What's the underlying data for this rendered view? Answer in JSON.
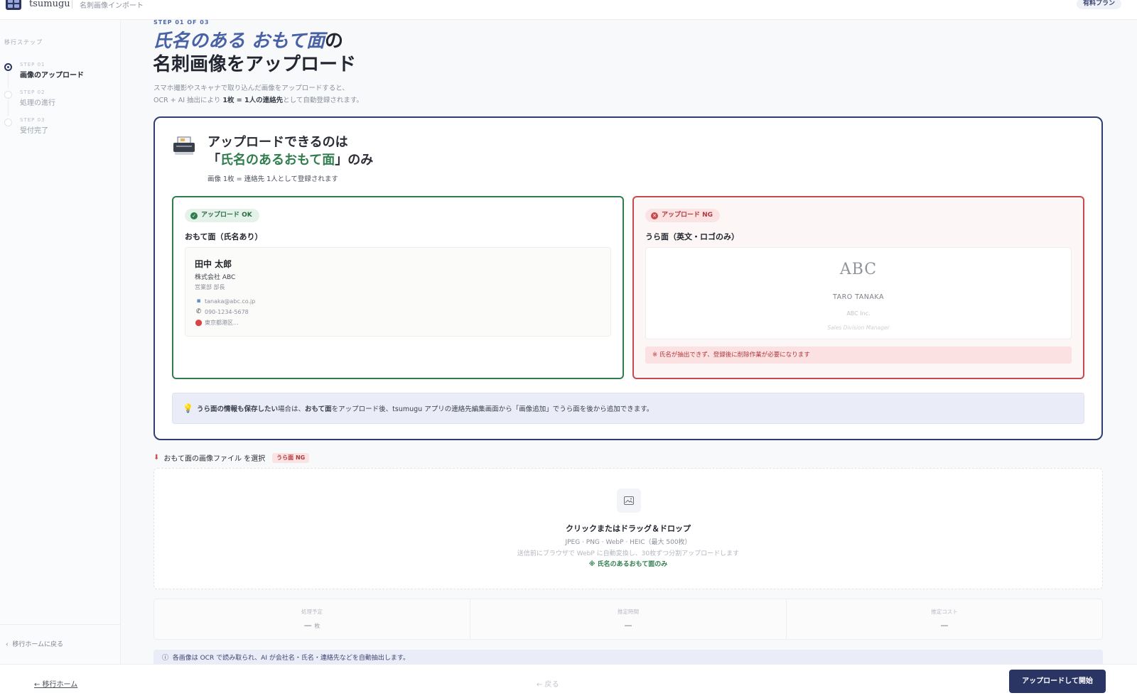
{
  "header": {
    "brand": "tsumugu",
    "breadcrumb": "名刺画像インポート",
    "plan_badge": "有料プラン"
  },
  "sidebar": {
    "section_label": "移行ステップ",
    "steps": [
      {
        "num": "STEP 01",
        "name": "画像のアップロード"
      },
      {
        "num": "STEP 02",
        "name": "処理の進行"
      },
      {
        "num": "STEP 03",
        "name": "受付完了"
      }
    ],
    "back_link": "移行ホームに戻る"
  },
  "main": {
    "kicker": "STEP 01 OF 03",
    "title_accent": "氏名のある おもて面",
    "title_suffix": "の",
    "title_line2": "名刺画像をアップロード",
    "desc_line1": "スマホ撮影やスキャナで取り込んだ画像をアップロードすると、",
    "desc_line2_prefix": "OCR + AI 抽出により ",
    "desc_line2_bold": "1枚 = 1人の連絡先",
    "desc_line2_suffix": "として自動登録されます。"
  },
  "notice": {
    "title_line1": "アップロードできるのは",
    "title_open": "「",
    "title_accent": "氏名のあるおもて面",
    "title_close": "」のみ",
    "subtitle": "画像 1枚 = 連絡先 1人として登録されます",
    "ok_panel": {
      "badge": "アップロード OK",
      "heading": "おもて面（氏名あり）",
      "card": {
        "name": "田中 太郎",
        "company": "株式会社 ABC",
        "role": "営業部 部長",
        "email": "tanaka@abc.co.jp",
        "phone": "090-1234-5678",
        "address": "東京都港区..."
      }
    },
    "ng_panel": {
      "badge": "アップロード NG",
      "heading": "うら面（英文・ロゴのみ）",
      "card": {
        "logo": "ABC",
        "name": "TARO TANAKA",
        "company": "ABC Inc.",
        "title": "Sales Division Manager"
      },
      "warning": "※ 氏名が抽出できず、登録後に削除作業が必要になります"
    },
    "tip": {
      "bold1": "うら面の情報も保存したい",
      "text1": "場合は、",
      "bold2": "おもて面",
      "text2": "をアップロード後、tsumugu アプリの連絡先編集画面から「画像追加」でうら面を後から追加できます。"
    }
  },
  "upload": {
    "label": "おもて面の画像ファイル を選択",
    "tag": "うら面 NG",
    "dropzone_title": "クリックまたはドラッグ＆ドロップ",
    "formats": "JPEG · PNG · WebP · HEIC（最大 500枚）",
    "note": "送信前にブラウザで WebP に自動変換し、30枚ずつ分割アップロードします",
    "only": "※ 氏名のあるおもて面のみ"
  },
  "stats": [
    {
      "label": "処理予定",
      "value": "—",
      "unit": "枚"
    },
    {
      "label": "推定時間",
      "value": "—",
      "unit": ""
    },
    {
      "label": "推定コスト",
      "value": "—",
      "unit": ""
    }
  ],
  "info": "各画像は OCR で読み取られ、AI が会社名・氏名・連絡先などを自動抽出します。",
  "footer": {
    "home": "← 移行ホーム",
    "back": "← 戻る",
    "primary": "アップロードして開始"
  },
  "colors": {
    "navy": "#2b3563",
    "ok_green": "#2f7d4d",
    "ng_red": "#c8494c",
    "accent_blue": "#4962a6"
  }
}
